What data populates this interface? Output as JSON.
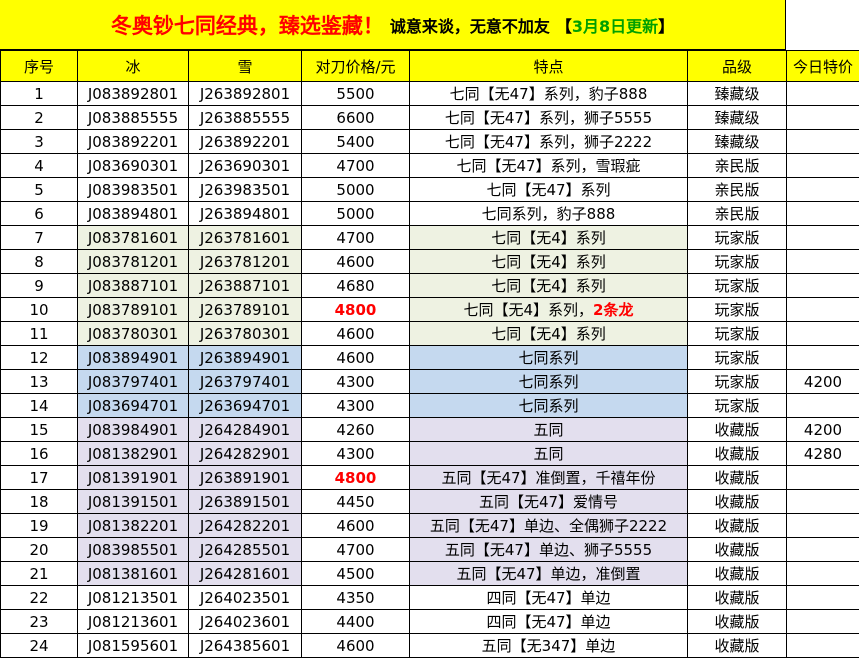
{
  "banner": {
    "title": "冬奥钞七同经典，臻选鉴藏！",
    "subtitle": "诚意来谈，无意不加友",
    "bracket_open": "【",
    "update": "3月8日更新",
    "bracket_close": "】"
  },
  "colors": {
    "header_bg": "#ffff00",
    "highlight_red": "#ff0000",
    "date_green": "#00a000",
    "group_green": "#eef2e2",
    "group_blue": "#c5d9ef",
    "group_purple": "#e3dfee"
  },
  "table": {
    "headers": [
      "序号",
      "冰",
      "雪",
      "对刀价格/元",
      "特点",
      "品级",
      "今日特价"
    ],
    "rows": [
      {
        "no": "1",
        "ice": "J083892801",
        "snow": "J263892801",
        "price": "5500",
        "feature": "七同【无47】系列，豹子888",
        "feature_extra": "",
        "grade": "臻藏级",
        "special": "",
        "group": "none",
        "price_red": false
      },
      {
        "no": "2",
        "ice": "J083885555",
        "snow": "J263885555",
        "price": "6600",
        "feature": "七同【无47】系列，狮子5555",
        "feature_extra": "",
        "grade": "臻藏级",
        "special": "",
        "group": "none",
        "price_red": false
      },
      {
        "no": "3",
        "ice": "J083892201",
        "snow": "J263892201",
        "price": "5400",
        "feature": "七同【无47】系列，狮子2222",
        "feature_extra": "",
        "grade": "臻藏级",
        "special": "",
        "group": "none",
        "price_red": false
      },
      {
        "no": "4",
        "ice": "J083690301",
        "snow": "J263690301",
        "price": "4700",
        "feature": "七同【无47】系列，雪瑕疵",
        "feature_extra": "",
        "grade": "亲民版",
        "special": "",
        "group": "none",
        "price_red": false
      },
      {
        "no": "5",
        "ice": "J083983501",
        "snow": "J263983501",
        "price": "5000",
        "feature": "七同【无47】系列",
        "feature_extra": "",
        "grade": "亲民版",
        "special": "",
        "group": "none",
        "price_red": false
      },
      {
        "no": "6",
        "ice": "J083894801",
        "snow": "J263894801",
        "price": "5000",
        "feature": "七同系列，豹子888",
        "feature_extra": "",
        "grade": "亲民版",
        "special": "",
        "group": "none",
        "price_red": false
      },
      {
        "no": "7",
        "ice": "J083781601",
        "snow": "J263781601",
        "price": "4700",
        "feature": "七同【无4】系列",
        "feature_extra": "",
        "grade": "玩家版",
        "special": "",
        "group": "green",
        "price_red": false
      },
      {
        "no": "8",
        "ice": "J083781201",
        "snow": "J263781201",
        "price": "4600",
        "feature": "七同【无4】系列",
        "feature_extra": "",
        "grade": "玩家版",
        "special": "",
        "group": "green",
        "price_red": false
      },
      {
        "no": "9",
        "ice": "J083887101",
        "snow": "J263887101",
        "price": "4680",
        "feature": "七同【无4】系列",
        "feature_extra": "",
        "grade": "玩家版",
        "special": "",
        "group": "green",
        "price_red": false
      },
      {
        "no": "10",
        "ice": "J083789101",
        "snow": "J263789101",
        "price": "4800",
        "feature": "七同【无4】系列，",
        "feature_extra": "2条龙",
        "grade": "玩家版",
        "special": "",
        "group": "green",
        "price_red": true
      },
      {
        "no": "11",
        "ice": "J083780301",
        "snow": "J263780301",
        "price": "4600",
        "feature": "七同【无4】系列",
        "feature_extra": "",
        "grade": "玩家版",
        "special": "",
        "group": "green",
        "price_red": false
      },
      {
        "no": "12",
        "ice": "J083894901",
        "snow": "J263894901",
        "price": "4600",
        "feature": "七同系列",
        "feature_extra": "",
        "grade": "玩家版",
        "special": "",
        "group": "blue",
        "price_red": false
      },
      {
        "no": "13",
        "ice": "J083797401",
        "snow": "J263797401",
        "price": "4300",
        "feature": "七同系列",
        "feature_extra": "",
        "grade": "玩家版",
        "special": "4200",
        "group": "blue",
        "price_red": false
      },
      {
        "no": "14",
        "ice": "J083694701",
        "snow": "J263694701",
        "price": "4300",
        "feature": "七同系列",
        "feature_extra": "",
        "grade": "玩家版",
        "special": "",
        "group": "blue",
        "price_red": false
      },
      {
        "no": "15",
        "ice": "J083984901",
        "snow": "J264284901",
        "price": "4260",
        "feature": "五同",
        "feature_extra": "",
        "grade": "收藏版",
        "special": "4200",
        "group": "purple",
        "price_red": false
      },
      {
        "no": "16",
        "ice": "J081382901",
        "snow": "J264282901",
        "price": "4300",
        "feature": "五同",
        "feature_extra": "",
        "grade": "收藏版",
        "special": "4280",
        "group": "purple",
        "price_red": false
      },
      {
        "no": "17",
        "ice": "J081391901",
        "snow": "J263891901",
        "price": "4800",
        "feature": "五同【无47】准倒置，千禧年份",
        "feature_extra": "",
        "grade": "收藏版",
        "special": "",
        "group": "purple",
        "price_red": true
      },
      {
        "no": "18",
        "ice": "J081391501",
        "snow": "J263891501",
        "price": "4450",
        "feature": "五同【无47】爱情号",
        "feature_extra": "",
        "grade": "收藏版",
        "special": "",
        "group": "purple",
        "price_red": false
      },
      {
        "no": "19",
        "ice": "J081382201",
        "snow": "J264282201",
        "price": "4600",
        "feature": "五同【无47】单边、全偶狮子2222",
        "feature_extra": "",
        "grade": "收藏版",
        "special": "",
        "group": "purple",
        "price_red": false
      },
      {
        "no": "20",
        "ice": "J083985501",
        "snow": "J264285501",
        "price": "4700",
        "feature": "五同【无47】单边、狮子5555",
        "feature_extra": "",
        "grade": "收藏版",
        "special": "",
        "group": "purple",
        "price_red": false
      },
      {
        "no": "21",
        "ice": "J081381601",
        "snow": "J264281601",
        "price": "4500",
        "feature": "五同【无47】单边，准倒置",
        "feature_extra": "",
        "grade": "收藏版",
        "special": "",
        "group": "purple",
        "price_red": false
      },
      {
        "no": "22",
        "ice": "J081213501",
        "snow": "J264023501",
        "price": "4350",
        "feature": "四同【无47】单边",
        "feature_extra": "",
        "grade": "收藏版",
        "special": "",
        "group": "none",
        "price_red": false
      },
      {
        "no": "23",
        "ice": "J081213601",
        "snow": "J264023601",
        "price": "4400",
        "feature": "四同【无47】单边",
        "feature_extra": "",
        "grade": "收藏版",
        "special": "",
        "group": "none",
        "price_red": false
      },
      {
        "no": "24",
        "ice": "J081595601",
        "snow": "J264385601",
        "price": "4600",
        "feature": "五同【无347】单边",
        "feature_extra": "",
        "grade": "收藏版",
        "special": "",
        "group": "none",
        "price_red": false
      }
    ]
  }
}
